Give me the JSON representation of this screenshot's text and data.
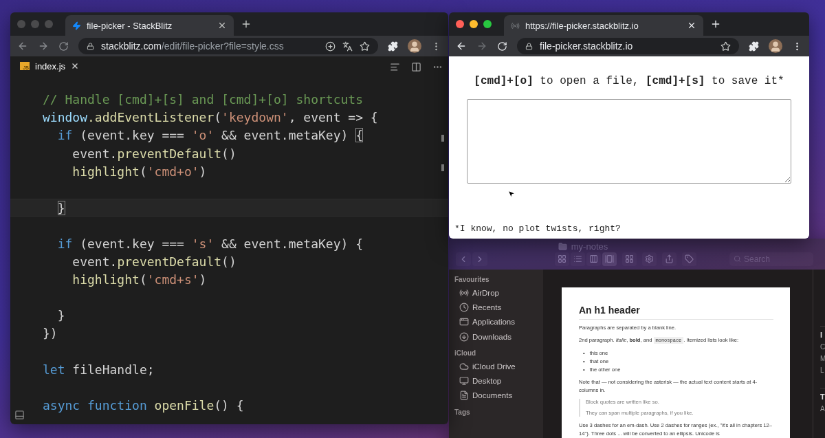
{
  "editor_window": {
    "active": false,
    "tab": {
      "title": "file-picker - StackBlitz"
    },
    "address": {
      "host": "stackblitz.com",
      "path": "/edit/file-picker?file=style.css"
    },
    "editor_tabs": [
      {
        "label": "index.js",
        "badge": "JS",
        "selected": true
      }
    ],
    "code": [
      {
        "current": false,
        "tokens": [
          {
            "kind": "comment",
            "text": "// Handle [cmd]+[s] and [cmd]+[o] shortcuts"
          }
        ]
      },
      {
        "current": false,
        "tokens": [
          {
            "kind": "variable",
            "text": "window"
          },
          {
            "kind": "function",
            "text": ".addEventListener"
          },
          {
            "kind": "plain",
            "text": "("
          },
          {
            "kind": "string",
            "text": "'keydown'"
          },
          {
            "kind": "plain",
            "text": ", event => {"
          }
        ],
        "children": [
          {
            "current": false,
            "tokens": [
              {
                "kind": "keyword",
                "text": "if"
              },
              {
                "kind": "plain",
                "text": " (event.key === "
              },
              {
                "kind": "string",
                "text": "'o'"
              },
              {
                "kind": "plain",
                "text": " && event.metaKey) "
              },
              {
                "kind": "bracket",
                "text": "{"
              }
            ],
            "children": [
              {
                "current": false,
                "tokens": [
                  {
                    "kind": "plain",
                    "text": "event."
                  },
                  {
                    "kind": "function",
                    "text": "preventDefault"
                  },
                  {
                    "kind": "plain",
                    "text": "()"
                  }
                ]
              },
              {
                "current": false,
                "tokens": [
                  {
                    "kind": "function",
                    "text": "highlight"
                  },
                  {
                    "kind": "plain",
                    "text": "("
                  },
                  {
                    "kind": "string",
                    "text": "'cmd+o'"
                  },
                  {
                    "kind": "plain",
                    "text": ")"
                  }
                ]
              },
              {
                "current": false
              }
            ]
          },
          {
            "current": true,
            "tokens": [
              {
                "kind": "bracket",
                "text": "}"
              }
            ]
          },
          {
            "current": false
          },
          {
            "current": false,
            "tokens": [
              {
                "kind": "keyword",
                "text": "if"
              },
              {
                "kind": "plain",
                "text": " (event.key === "
              },
              {
                "kind": "string",
                "text": "'s'"
              },
              {
                "kind": "plain",
                "text": " && event.metaKey) {"
              }
            ],
            "children": [
              {
                "current": false,
                "tokens": [
                  {
                    "kind": "plain",
                    "text": "event."
                  },
                  {
                    "kind": "function",
                    "text": "preventDefault"
                  },
                  {
                    "kind": "plain",
                    "text": "()"
                  }
                ]
              },
              {
                "current": false,
                "tokens": [
                  {
                    "kind": "function",
                    "text": "highlight"
                  },
                  {
                    "kind": "plain",
                    "text": "("
                  },
                  {
                    "kind": "string",
                    "text": "'cmd+s'"
                  },
                  {
                    "kind": "plain",
                    "text": ")"
                  }
                ]
              },
              {
                "current": false
              }
            ]
          },
          {
            "current": false,
            "tokens": [
              {
                "kind": "plain",
                "text": "}"
              }
            ]
          }
        ]
      },
      {
        "current": false,
        "tokens": [
          {
            "kind": "plain",
            "text": "})"
          }
        ]
      },
      {
        "current": false
      },
      {
        "current": false,
        "tokens": [
          {
            "kind": "keyword",
            "text": "let"
          },
          {
            "kind": "plain",
            "text": " fileHandle;"
          }
        ]
      },
      {
        "current": false
      },
      {
        "current": false,
        "tokens": [
          {
            "kind": "keyword",
            "text": "async function"
          },
          {
            "kind": "function",
            "text": " openFile"
          },
          {
            "kind": "plain",
            "text": "() {"
          }
        ]
      }
    ]
  },
  "browser_window": {
    "active": true,
    "tab": {
      "title": "https://file-picker.stackblitz.io"
    },
    "address": {
      "host": "file-picker.stackblitz.io"
    },
    "forward_disabled": true,
    "page": {
      "heading": "**[cmd]+[o]** to open a file, **[cmd]+[s]** to save it*",
      "footnote": "*I know, no plot twists, right?"
    }
  },
  "finder_window": {
    "active": false,
    "title": "my-notes",
    "views": [
      {
        "kind": "icons",
        "selected": false
      },
      {
        "kind": "list",
        "selected": false
      },
      {
        "kind": "columns",
        "selected": false
      },
      {
        "kind": "gallery",
        "selected": true
      }
    ],
    "search": {
      "placeholder": "Search"
    },
    "sidebar": [
      {
        "title": "Favourites",
        "items": [
          {
            "kind": "airdrop",
            "label": "AirDrop"
          },
          {
            "kind": "recents",
            "label": "Recents"
          },
          {
            "kind": "applications",
            "label": "Applications"
          },
          {
            "kind": "downloads",
            "label": "Downloads"
          }
        ]
      },
      {
        "title": "iCloud",
        "items": [
          {
            "kind": "cloud",
            "label": "iCloud Drive"
          },
          {
            "kind": "desktop",
            "label": "Desktop"
          },
          {
            "kind": "documents",
            "label": "Documents"
          }
        ]
      },
      {
        "title": "Tags"
      }
    ],
    "preview": {
      "heading": "An h1 header",
      "blocks": [
        {
          "kind": "p",
          "parts": [
            {
              "kind": "text",
              "text": "Paragraphs are separated by a blank line."
            }
          ]
        },
        {
          "kind": "p",
          "parts": [
            {
              "kind": "text",
              "text": "2nd paragraph. *Italic*, **bold**, and "
            },
            {
              "kind": "code",
              "text": "monospace"
            },
            {
              "kind": "text",
              "text": ". Itemized lists look like:"
            }
          ]
        },
        {
          "kind": "ul",
          "items": [
            {
              "marker": "•",
              "text": "this one"
            },
            {
              "marker": "•",
              "text": "that one"
            },
            {
              "marker": "•",
              "text": "the other one"
            }
          ]
        },
        {
          "kind": "p",
          "parts": [
            {
              "kind": "text",
              "text": "Note that — not considering the asterisk — the actual text content starts at 4-columns in."
            }
          ]
        },
        {
          "kind": "quote",
          "items": [
            "Block quotes are written like so.",
            "They can span multiple paragraphs, if you like."
          ]
        },
        {
          "kind": "p",
          "parts": [
            {
              "kind": "text",
              "text": "Use 3 dashes for an em-dash. Use 2 dashes for ranges (ex., \"it's all in chapters 12–14\"). Three dots ... will be converted to an ellipsis. Unicode is"
            }
          ]
        }
      ]
    },
    "inspector": [
      {
        "title": "I",
        "lines": [
          "C",
          "M",
          "L"
        ]
      },
      {
        "title": "T",
        "lines": [
          "A"
        ]
      }
    ]
  }
}
